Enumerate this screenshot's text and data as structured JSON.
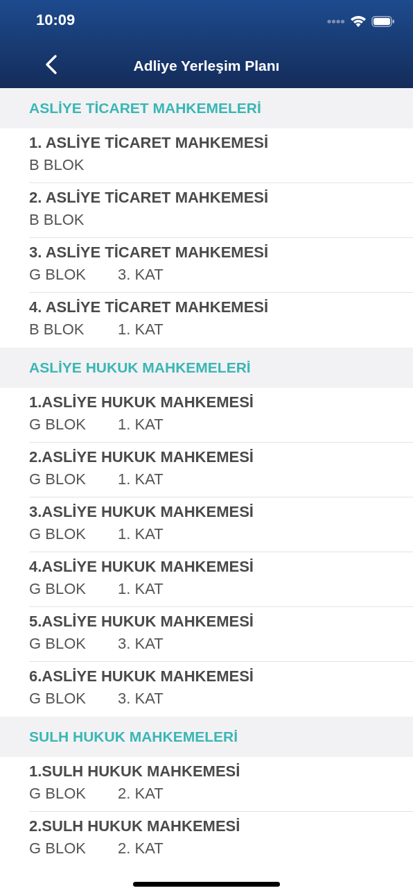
{
  "status_bar": {
    "time": "10:09"
  },
  "nav": {
    "title": "Adliye Yerleşim Planı"
  },
  "sections": [
    {
      "title": "ASLİYE TİCARET MAHKEMELERİ",
      "items": [
        {
          "name": "1. ASLİYE TİCARET MAHKEMESİ",
          "block": "B BLOK"
        },
        {
          "name": "2. ASLİYE TİCARET MAHKEMESİ",
          "block": "B BLOK"
        },
        {
          "name": "3. ASLİYE TİCARET MAHKEMESİ",
          "block": "G BLOK",
          "floor": "3. KAT"
        },
        {
          "name": "4. ASLİYE TİCARET MAHKEMESİ",
          "block": "B BLOK",
          "floor": "1. KAT"
        }
      ]
    },
    {
      "title": "ASLİYE HUKUK MAHKEMELERİ",
      "items": [
        {
          "name": "1.ASLİYE HUKUK MAHKEMESİ",
          "block": "G BLOK",
          "floor": "1. KAT"
        },
        {
          "name": "2.ASLİYE HUKUK MAHKEMESİ",
          "block": "G BLOK",
          "floor": "1. KAT"
        },
        {
          "name": "3.ASLİYE HUKUK MAHKEMESİ",
          "block": "G BLOK",
          "floor": "1. KAT"
        },
        {
          "name": "4.ASLİYE HUKUK MAHKEMESİ",
          "block": "G BLOK",
          "floor": "1. KAT"
        },
        {
          "name": "5.ASLİYE HUKUK MAHKEMESİ",
          "block": "G BLOK",
          "floor": "3. KAT"
        },
        {
          "name": "6.ASLİYE HUKUK MAHKEMESİ",
          "block": "G BLOK",
          "floor": "3. KAT"
        }
      ]
    },
    {
      "title": "SULH HUKUK MAHKEMELERİ",
      "items": [
        {
          "name": "1.SULH HUKUK MAHKEMESİ",
          "block": "G BLOK",
          "floor": "2. KAT"
        },
        {
          "name": "2.SULH HUKUK MAHKEMESİ",
          "block": "G BLOK",
          "floor": "2. KAT"
        }
      ]
    }
  ]
}
